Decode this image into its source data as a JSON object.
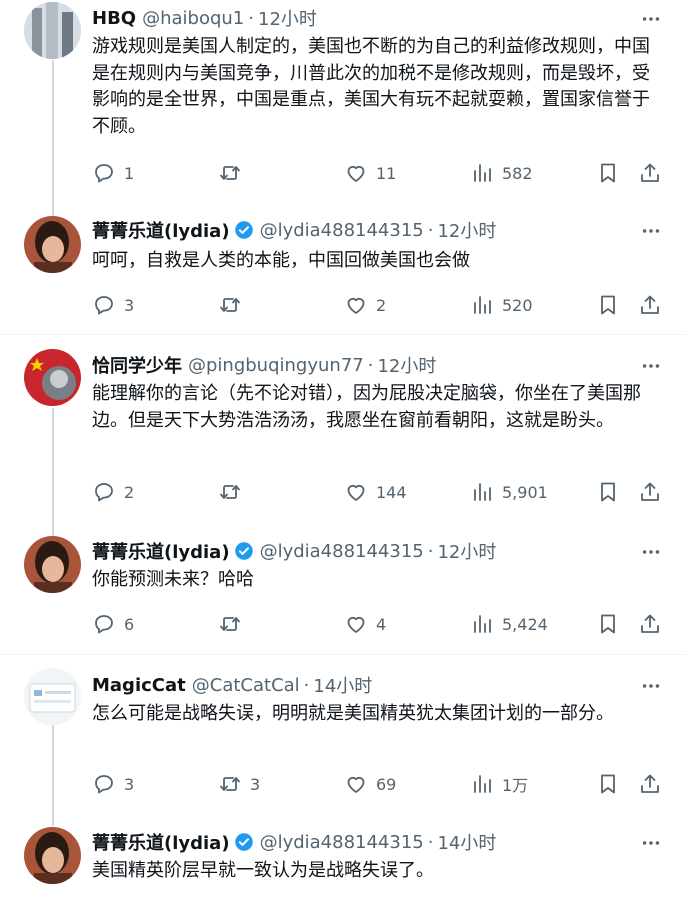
{
  "tweets": [
    {
      "name": "HBQ",
      "handle": "@haiboqu1",
      "time": "12小时",
      "verified": false,
      "text": "游戏规则是美国人制定的，美国也不断的为自己的利益修改规则，中国是在规则内与美国竞争，川普此次的加税不是修改规则，而是毁坏，受影响的是全世界，中国是重点，美国大有玩不起就耍赖，置国家信誉于不顾。",
      "replies": "1",
      "retweets": "",
      "likes": "11",
      "views": "582"
    },
    {
      "name": "菁菁乐道(lydia)",
      "handle": "@lydia488144315",
      "time": "12小时",
      "verified": true,
      "text": "呵呵，自救是人类的本能，中国回做美国也会做",
      "replies": "3",
      "retweets": "",
      "likes": "2",
      "views": "520"
    },
    {
      "name": "恰同学少年",
      "handle": "@pingbuqingyun77",
      "time": "12小时",
      "verified": false,
      "text": "能理解你的言论（先不论对错），因为屁股决定脑袋，你坐在了美国那边。但是天下大势浩浩汤汤，我愿坐在窗前看朝阳，这就是盼头。",
      "replies": "2",
      "retweets": "",
      "likes": "144",
      "views": "5,901"
    },
    {
      "name": "菁菁乐道(lydia)",
      "handle": "@lydia488144315",
      "time": "12小时",
      "verified": true,
      "text": "你能预测未来？哈哈",
      "replies": "6",
      "retweets": "",
      "likes": "4",
      "views": "5,424"
    },
    {
      "name": "MagicCat",
      "handle": "@CatCatCal",
      "time": "14小时",
      "verified": false,
      "text": "怎么可能是战略失误，明明就是美国精英犹太集团计划的一部分。",
      "replies": "3",
      "retweets": "3",
      "likes": "69",
      "views": "1万"
    },
    {
      "name": "菁菁乐道(lydia)",
      "handle": "@lydia488144315",
      "time": "14小时",
      "verified": true,
      "text": "美国精英阶层早就一致认为是战略失误了。",
      "replies": "",
      "retweets": "",
      "likes": "",
      "views": ""
    }
  ],
  "colors": {
    "verified": "#1d9bf0",
    "secondary_text": "#536471",
    "text": "#0f1419"
  },
  "icons": {
    "reply": "reply-icon",
    "retweet": "retweet-icon",
    "like": "heart-icon",
    "views": "views-icon",
    "bookmark": "bookmark-icon",
    "share": "share-icon",
    "more": "more-icon"
  }
}
